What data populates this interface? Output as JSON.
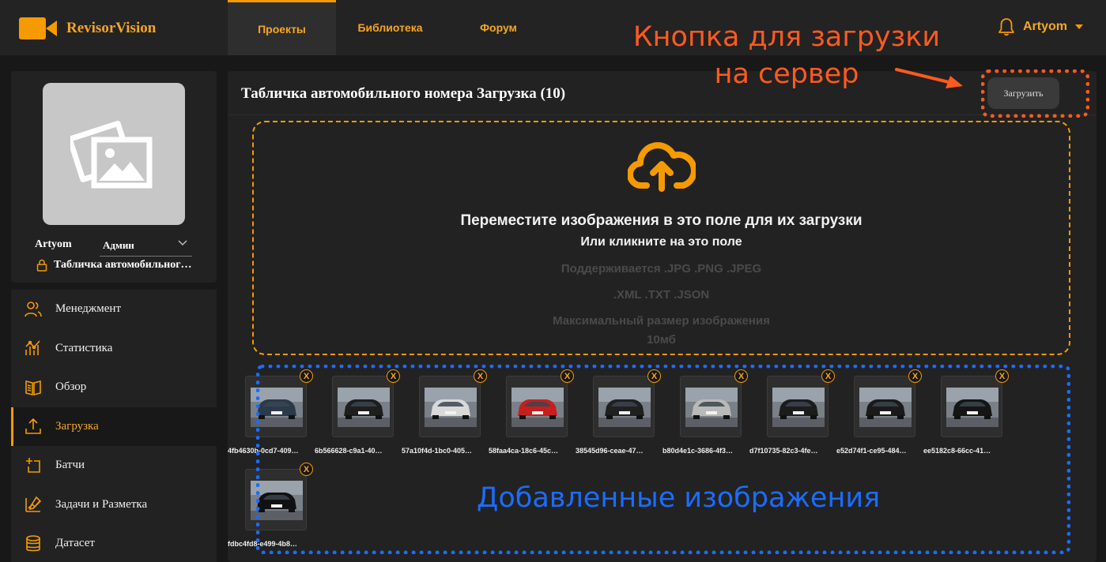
{
  "app": {
    "name": "RevisorVision"
  },
  "nav": {
    "tabs": [
      {
        "label": "Проекты",
        "active": true
      },
      {
        "label": "Библиотека",
        "active": false
      },
      {
        "label": "Форум",
        "active": false
      }
    ]
  },
  "user": {
    "name": "Artyom",
    "role": "Админ",
    "project": "Табличка автомобильног…"
  },
  "menu": {
    "items": [
      {
        "label": "Менеджмент",
        "icon": "users-icon"
      },
      {
        "label": "Статистика",
        "icon": "stats-icon"
      },
      {
        "label": "Обзор",
        "icon": "book-icon"
      },
      {
        "label": "Загрузка",
        "icon": "upload-icon",
        "active": true
      },
      {
        "label": "Батчи",
        "icon": "batch-add-icon"
      },
      {
        "label": "Задачи и Разметка",
        "icon": "tasks-icon"
      },
      {
        "label": "Датасет",
        "icon": "database-icon"
      }
    ]
  },
  "main": {
    "title": "Табличка автомобильного номера Загрузка (10)",
    "upload_button": "Загрузить",
    "dropzone": {
      "title": "Переместите изображения в это поле для их загрузки",
      "subtitle": "Или кликните на это поле",
      "formats_1": "Поддерживается .JPG .PNG .JPEG",
      "formats_2": ".XML .TXT .JSON",
      "max_size_label": "Максимальный размер изображения",
      "max_size_value": "10мб"
    },
    "remove_label": "X",
    "files": [
      {
        "name": "4fb4630b-0cd7-409…",
        "car_color": "#2b3a4a"
      },
      {
        "name": "6b566628-c9a1-40…",
        "car_color": "#1e1e1e"
      },
      {
        "name": "57a10f4d-1bc0-405…",
        "car_color": "#d9d9d9"
      },
      {
        "name": "58faa4ca-18c6-45c…",
        "car_color": "#c81e1e"
      },
      {
        "name": "38545d96-ceae-47…",
        "car_color": "#202020"
      },
      {
        "name": "b80d4e1c-3686-4f3…",
        "car_color": "#b9b9b9"
      },
      {
        "name": "d7f10735-82c3-4fe…",
        "car_color": "#1c1c1c"
      },
      {
        "name": "e52d74f1-ce95-484…",
        "car_color": "#1a1a1a"
      },
      {
        "name": "ee5182c8-66cc-41…",
        "car_color": "#151515"
      },
      {
        "name": "fdbc4fd8-e499-4b8…",
        "car_color": "#111111"
      }
    ]
  },
  "annotations": {
    "upload_button_note": "Кнопка для загрузки на сервер",
    "images_note": "Добавленные изображения"
  },
  "colors": {
    "accent": "#f59a00",
    "annotation_orange": "#ff5a1f",
    "annotation_blue": "#1a6dff",
    "background": "#181818",
    "panel": "#222222"
  }
}
